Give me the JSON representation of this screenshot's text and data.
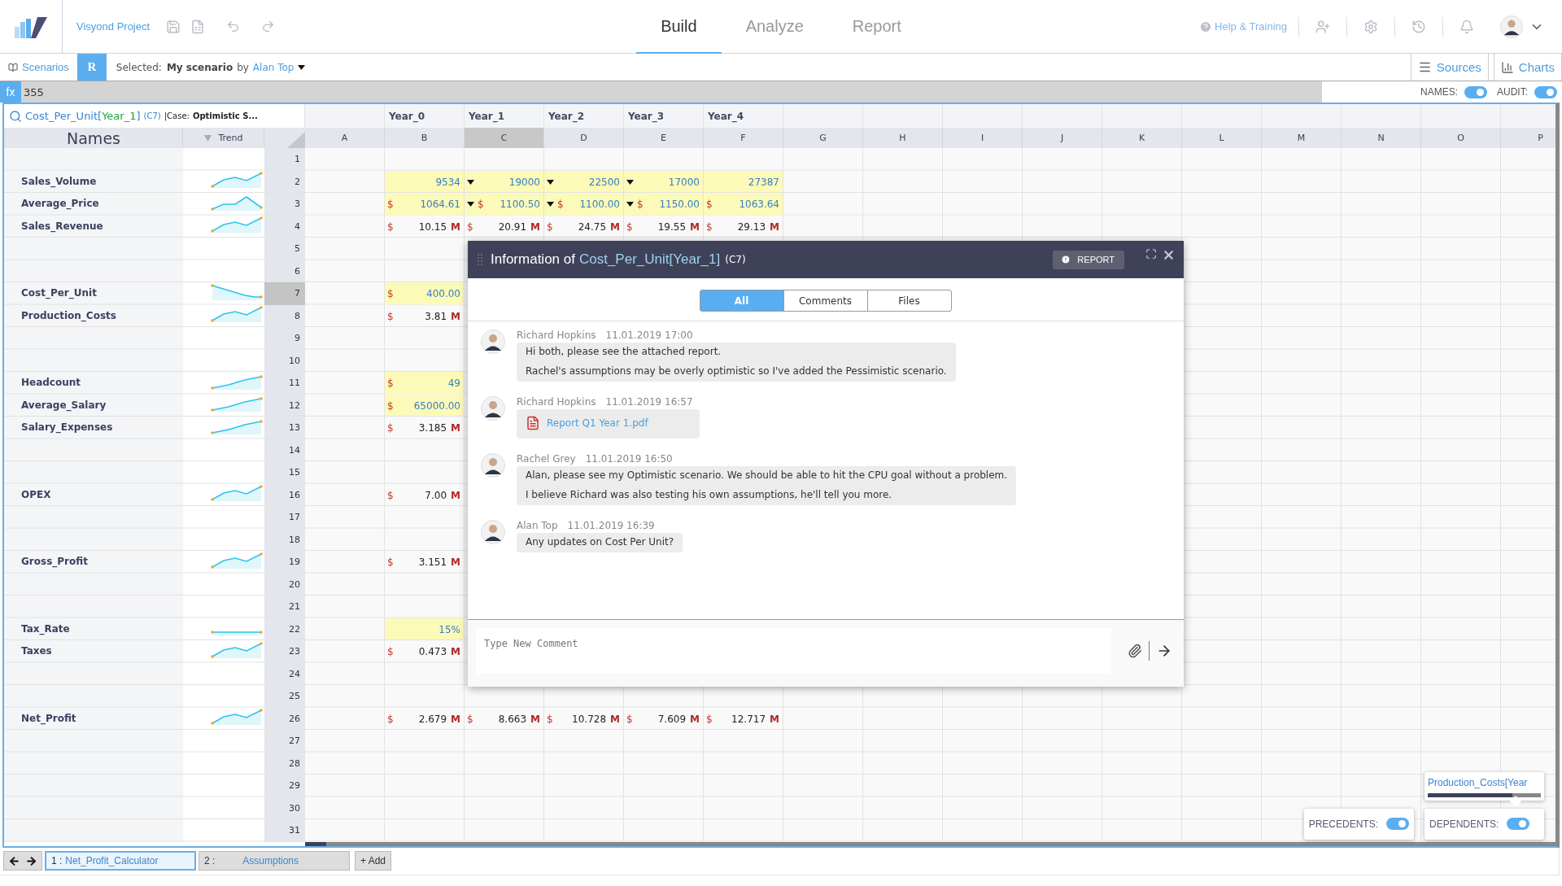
{
  "app": {
    "project": "Visyond Project"
  },
  "nav_tabs": [
    {
      "label": "Build",
      "selected": true
    },
    {
      "label": "Analyze",
      "selected": false
    },
    {
      "label": "Report",
      "selected": false
    }
  ],
  "help": "Help & Training",
  "scenario_bar": {
    "scenarios": "Scenarios",
    "badge": "R",
    "selected_label": "Selected:",
    "scenario": "My scenario",
    "by": "by",
    "owner": "Alan Top",
    "sources": "Sources",
    "charts": "Charts"
  },
  "formula_bar": {
    "fx": "fx",
    "value": "355",
    "toggles": [
      {
        "label": "NAMES:",
        "on": true
      },
      {
        "label": "AUDIT:",
        "on": true
      }
    ]
  },
  "name_box": {
    "parts": [
      {
        "text": "Cost_Per_Unit[",
        "kind": "name"
      },
      {
        "text": "Year_1",
        "kind": "index"
      },
      {
        "text": "]",
        "kind": "name"
      }
    ],
    "ref": "(C7)",
    "case_label": "|Case:",
    "case": "Optimistic S..."
  },
  "sheet": {
    "names_header": "Names",
    "trend_header": "Trend",
    "columns": [
      {
        "label": "A",
        "selected": false
      },
      {
        "label": "B",
        "year": "Year_0",
        "selected": false
      },
      {
        "label": "C",
        "year": "Year_1",
        "selected": true
      },
      {
        "label": "D",
        "year": "Year_2",
        "selected": false
      },
      {
        "label": "E",
        "year": "Year_3",
        "selected": false
      },
      {
        "label": "F",
        "year": "Year_4",
        "selected": false
      },
      {
        "label": "G",
        "selected": false
      },
      {
        "label": "H",
        "selected": false
      },
      {
        "label": "I",
        "selected": false
      },
      {
        "label": "J",
        "selected": false
      },
      {
        "label": "K",
        "selected": false
      },
      {
        "label": "L",
        "selected": false
      },
      {
        "label": "M",
        "selected": false
      },
      {
        "label": "N",
        "selected": false
      },
      {
        "label": "O",
        "selected": false
      },
      {
        "label": "P",
        "selected": false
      }
    ],
    "rows": [
      {
        "number": "1",
        "selected": false
      },
      {
        "number": "2",
        "selected": false,
        "name": "Sales_Volume",
        "kind": "wave",
        "cells": [
          null,
          {
            "value": "9534",
            "input": true,
            "dropdown": false
          },
          {
            "value": "19000",
            "input": true,
            "dropdown": true
          },
          {
            "value": "22500",
            "input": true,
            "dropdown": true
          },
          {
            "value": "17000",
            "input": true,
            "dropdown": true
          },
          {
            "value": "27387",
            "input": true,
            "dropdown": false
          }
        ]
      },
      {
        "number": "3",
        "selected": false,
        "name": "Average_Price",
        "kind": "spike",
        "cells": [
          null,
          {
            "prefix": "$",
            "value": "1064.61",
            "input": true,
            "dropdown": false
          },
          {
            "prefix": "$",
            "value": "1100.50",
            "input": true,
            "dropdown": true
          },
          {
            "prefix": "$",
            "value": "1100.00",
            "input": true,
            "dropdown": true
          },
          {
            "prefix": "$",
            "value": "1150.00",
            "input": true,
            "dropdown": true
          },
          {
            "prefix": "$",
            "value": "1063.64",
            "input": true,
            "dropdown": false
          }
        ]
      },
      {
        "number": "4",
        "selected": false,
        "name": "Sales_Revenue",
        "kind": "wave",
        "cells": [
          null,
          {
            "prefix": "$",
            "value": "10.15",
            "unit": "M",
            "input": false,
            "dropdown": false
          },
          {
            "prefix": "$",
            "value": "20.91",
            "unit": "M",
            "input": false,
            "dropdown": false
          },
          {
            "prefix": "$",
            "value": "24.75",
            "unit": "M",
            "input": false,
            "dropdown": false
          },
          {
            "prefix": "$",
            "value": "19.55",
            "unit": "M",
            "input": false,
            "dropdown": false
          },
          {
            "prefix": "$",
            "value": "29.13",
            "unit": "M",
            "input": false,
            "dropdown": false
          }
        ]
      },
      {
        "number": "5",
        "selected": false
      },
      {
        "number": "6",
        "selected": false
      },
      {
        "number": "7",
        "selected": true,
        "name": "Cost_Per_Unit",
        "kind": "falling",
        "cells": [
          null,
          {
            "prefix": "$",
            "value": "400.00",
            "input": true,
            "dropdown": false
          }
        ]
      },
      {
        "number": "8",
        "selected": false,
        "name": "Production_Costs",
        "kind": "wave",
        "cells": [
          null,
          {
            "prefix": "$",
            "value": "3.81",
            "unit": "M",
            "input": false,
            "dropdown": false
          }
        ]
      },
      {
        "number": "9",
        "selected": false
      },
      {
        "number": "10",
        "selected": false
      },
      {
        "number": "11",
        "selected": false,
        "name": "Headcount",
        "kind": "rising",
        "cells": [
          null,
          {
            "prefix": "$",
            "value": "49",
            "input": true,
            "dropdown": false
          }
        ]
      },
      {
        "number": "12",
        "selected": false,
        "name": "Average_Salary",
        "kind": "rising",
        "cells": [
          null,
          {
            "prefix": "$",
            "value": "65000.00",
            "input": true,
            "dropdown": false
          }
        ]
      },
      {
        "number": "13",
        "selected": false,
        "name": "Salary_Expenses",
        "kind": "rising",
        "cells": [
          null,
          {
            "prefix": "$",
            "value": "3.185",
            "unit": "M",
            "input": false,
            "dropdown": false
          }
        ]
      },
      {
        "number": "14",
        "selected": false
      },
      {
        "number": "15",
        "selected": false
      },
      {
        "number": "16",
        "selected": false,
        "name": "OPEX",
        "kind": "wave",
        "cells": [
          null,
          {
            "prefix": "$",
            "value": "7.00",
            "unit": "M",
            "input": false,
            "dropdown": false
          }
        ]
      },
      {
        "number": "17",
        "selected": false
      },
      {
        "number": "18",
        "selected": false
      },
      {
        "number": "19",
        "selected": false,
        "name": "Gross_Profit",
        "kind": "wave",
        "cells": [
          null,
          {
            "prefix": "$",
            "value": "3.151",
            "unit": "M",
            "input": false,
            "dropdown": false
          }
        ]
      },
      {
        "number": "20",
        "selected": false
      },
      {
        "number": "21",
        "selected": false
      },
      {
        "number": "22",
        "selected": false,
        "name": "Tax_Rate",
        "kind": "flat",
        "cells": [
          null,
          {
            "value": "15%",
            "input": true,
            "dropdown": false
          }
        ]
      },
      {
        "number": "23",
        "selected": false,
        "name": "Taxes",
        "kind": "wave",
        "cells": [
          null,
          {
            "prefix": "$",
            "value": "0.473",
            "unit": "M",
            "input": false,
            "dropdown": false
          }
        ]
      },
      {
        "number": "24",
        "selected": false
      },
      {
        "number": "25",
        "selected": false
      },
      {
        "number": "26",
        "selected": false,
        "name": "Net_Profit",
        "kind": "wave",
        "cells": [
          null,
          {
            "prefix": "$",
            "value": "2.679",
            "unit": "M",
            "input": false,
            "dropdown": false
          },
          {
            "prefix": "$",
            "value": "8.663",
            "unit": "M",
            "input": false,
            "dropdown": false
          },
          {
            "prefix": "$",
            "value": "10.728",
            "unit": "M",
            "input": false,
            "dropdown": false
          },
          {
            "prefix": "$",
            "value": "7.609",
            "unit": "M",
            "input": false,
            "dropdown": false
          },
          {
            "prefix": "$",
            "value": "12.717",
            "unit": "M",
            "input": false,
            "dropdown": false
          }
        ]
      },
      {
        "number": "27",
        "selected": false
      },
      {
        "number": "28",
        "selected": false
      },
      {
        "number": "29",
        "selected": false
      },
      {
        "number": "30",
        "selected": false
      },
      {
        "number": "31",
        "selected": false
      }
    ]
  },
  "dialog": {
    "title": "Information of",
    "subject": "Cost_Per_Unit[Year_1]",
    "ref": "(C7)",
    "report": "REPORT",
    "tabs": [
      {
        "label": "All",
        "selected": true
      },
      {
        "label": "Comments",
        "selected": false
      },
      {
        "label": "Files",
        "selected": false
      }
    ],
    "comments": [
      {
        "kind": "text",
        "author": "Richard Hopkins",
        "time": "11.01.2019 17:00",
        "paragraphs": [
          "Hi both, please see the attached report.",
          "Rachel's assumptions may be overly optimistic so I've added the Pessimistic scenario."
        ]
      },
      {
        "kind": "file",
        "author": "Richard Hopkins",
        "time": "11.01.2019 16:57",
        "file": "Report Q1 Year 1.pdf"
      },
      {
        "kind": "text",
        "author": "Rachel Grey",
        "time": "11.01.2019 16:50",
        "paragraphs": [
          "Alan, please see my Optimistic scenario. We should be able to hit the CPU goal without a problem.",
          "I believe Richard was also testing his own assumptions, he'll tell you more."
        ]
      },
      {
        "kind": "text",
        "author": "Alan Top",
        "time": "11.01.2019 16:39",
        "paragraphs": [
          "Any updates on Cost Per Unit?"
        ]
      }
    ],
    "input": {
      "placeholder": "Type New Comment"
    }
  },
  "audit": {
    "tooltip": {
      "text": "Production_Costs[Year",
      "level": 0.75
    },
    "toggles": [
      {
        "label": "PRECEDENTS:",
        "on": true
      },
      {
        "label": "DEPENDENTS:",
        "on": true
      }
    ]
  },
  "sheet_tabs": [
    {
      "number": "1 :",
      "label": "Net_Profit_Calculator",
      "selected": true
    },
    {
      "number": "2 :",
      "label": "Assumptions",
      "selected": false
    }
  ],
  "add_sheet": "+ Add"
}
